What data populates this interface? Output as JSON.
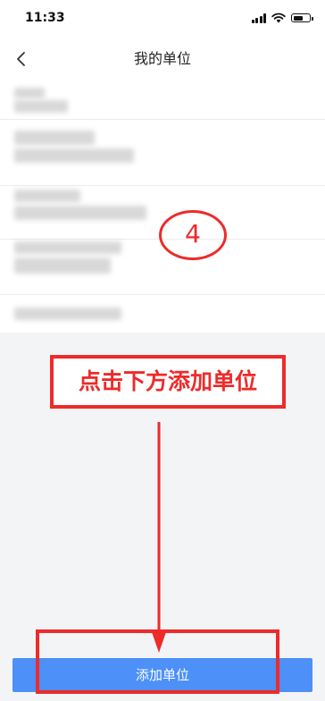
{
  "status_bar": {
    "time": "11:33"
  },
  "header": {
    "title": "我的单位"
  },
  "annotation": {
    "step_number": "4",
    "instruction": "点击下方添加单位"
  },
  "footer": {
    "add_button_label": "添加单位"
  },
  "colors": {
    "accent_blue": "#4c90f8",
    "annotation_red": "#ee2a2a",
    "page_background": "#f3f4f6"
  },
  "icons": [
    "back-chevron-icon",
    "cellular-signal-icon",
    "wifi-icon",
    "battery-icon"
  ]
}
